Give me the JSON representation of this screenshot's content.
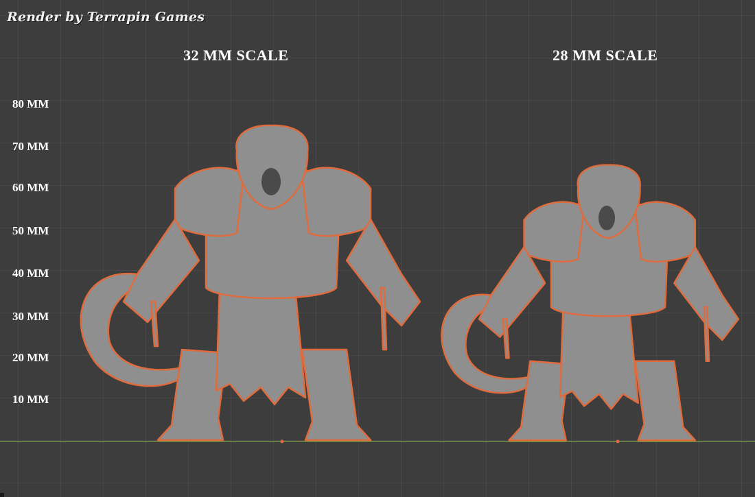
{
  "watermark": "Render by Terrapin Games",
  "scales": {
    "left": "32 MM SCALE",
    "right": "28 MM SCALE"
  },
  "ruler": {
    "ticks": [
      "80 MM",
      "70 MM",
      "60 MM",
      "50 MM",
      "40 MM",
      "30 MM",
      "20 MM",
      "10 MM"
    ]
  },
  "colors": {
    "background": "#3d3d3d",
    "ground": "#8bb04a",
    "outline": "#e06b3c",
    "model": "#8f8f8f"
  },
  "icons": {
    "model": "gorilla-miniature-icon"
  }
}
